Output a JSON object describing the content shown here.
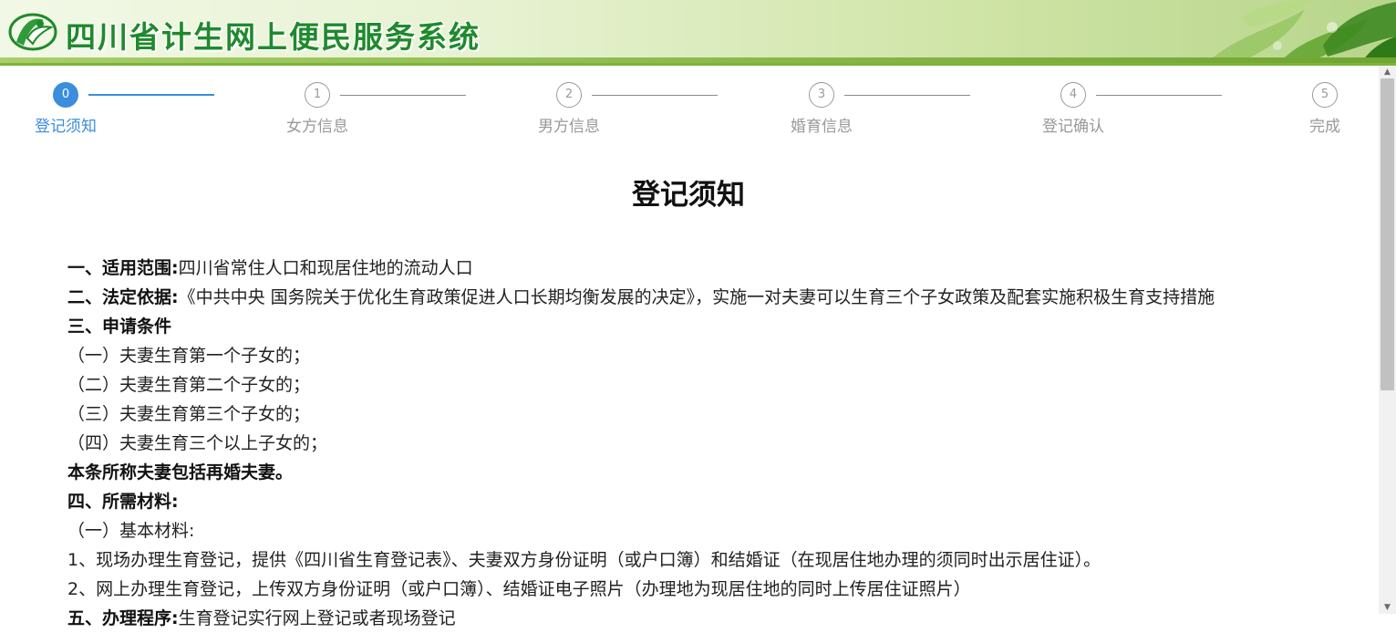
{
  "header": {
    "title": "四川省计生网上便民服务系统"
  },
  "steps": [
    {
      "num": "0",
      "label": "登记须知",
      "active": true
    },
    {
      "num": "1",
      "label": "女方信息",
      "active": false
    },
    {
      "num": "2",
      "label": "男方信息",
      "active": false
    },
    {
      "num": "3",
      "label": "婚育信息",
      "active": false
    },
    {
      "num": "4",
      "label": "登记确认",
      "active": false
    },
    {
      "num": "5",
      "label": "完成",
      "active": false
    }
  ],
  "notice": {
    "title": "登记须知",
    "scope_label": "一、适用范围:",
    "scope_text": "四川省常住人口和现居住地的流动人口",
    "basis_label": "二、法定依据:",
    "basis_text": "《中共中央 国务院关于优化生育政策促进人口长期均衡发展的决定》，实施一对夫妻可以生育三个子女政策及配套实施积极生育支持措施",
    "conditions_label": "三、申请条件",
    "conditions": [
      "（一）夫妻生育第一个子女的；",
      "（二）夫妻生育第二个子女的；",
      "（三）夫妻生育第三个子女的；",
      "（四）夫妻生育三个以上子女的；"
    ],
    "remarriage_note": "本条所称夫妻包括再婚夫妻。",
    "materials_label": "四、所需材料:",
    "basic_materials": "（一）基本材料:",
    "materials": [
      "1、现场办理生育登记，提供《四川省生育登记表》、夫妻双方身份证明（或户口簿）和结婚证（在现居住地办理的须同时出示居住证）。",
      "2、网上办理生育登记，上传双方身份证明（或户口簿）、结婚证电子照片（办理地为现居住地的同时上传居住证照片）"
    ],
    "procedure_label": "五、办理程序:",
    "procedure_text": "生育登记实行网上登记或者现场登记"
  },
  "colors": {
    "accent": "#3b8ede",
    "brand_green": "#1f8a2c"
  }
}
